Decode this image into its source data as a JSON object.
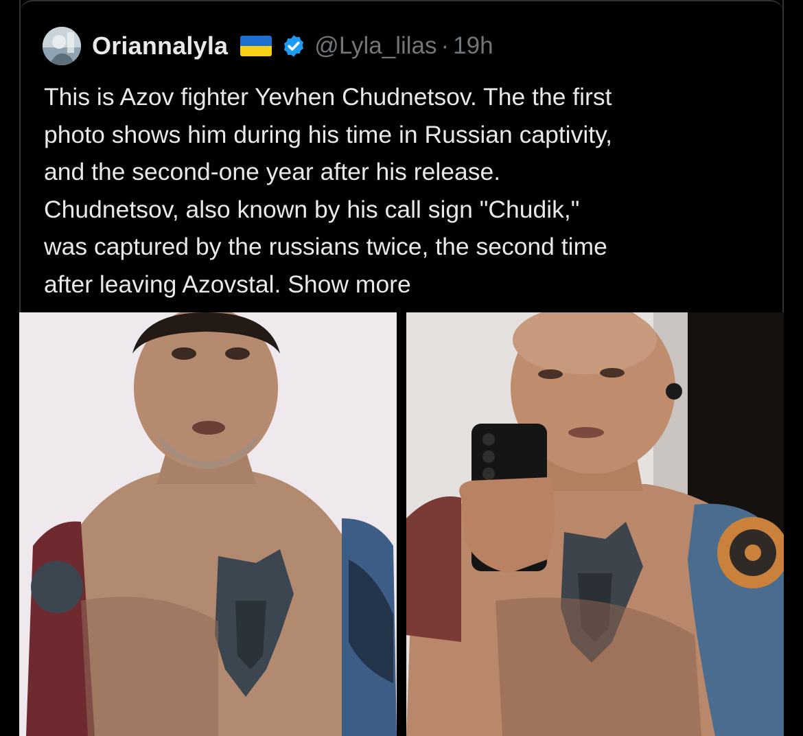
{
  "tweet": {
    "display_name": "Oriannalyla",
    "handle": "@Lyla_lilas",
    "separator": "·",
    "time": "19h",
    "flag_icon": "ukraine-flag-icon",
    "verified_icon": "verified-badge-icon",
    "verified_color": "#1d9bf0",
    "text": "This is Azov fighter Yevhen Chudnetsov. The the first\nphoto shows him during his time in Russian captivity,\nand the second-one year after his release.\nChudnetsov, also known by his call sign \"Chudik,\"\nwas captured by the russians twice, the second time\nafter leaving Azovstal.",
    "show_more": "Show more"
  },
  "media": [
    {
      "kind": "photo",
      "subject": "thin shirtless man with chest and arm tattoos"
    },
    {
      "kind": "photo",
      "subject": "shirtless man taking mirror selfie with phone, chest and arm tattoos"
    }
  ],
  "colors": {
    "background": "#000000",
    "text": "#e7e9ea",
    "secondary_text": "#71767b",
    "border": "#2f3336"
  }
}
